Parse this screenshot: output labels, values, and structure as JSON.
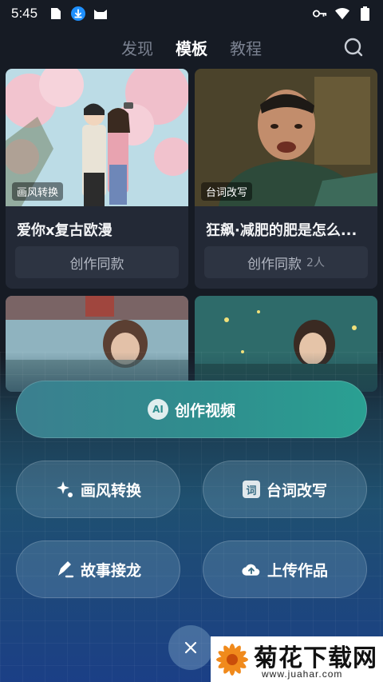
{
  "status_bar": {
    "time": "5:45",
    "left_icons": [
      "file-icon",
      "download-icon",
      "cat-icon"
    ],
    "right_icons": [
      "key-icon",
      "wifi-icon",
      "battery-icon"
    ]
  },
  "tabs": [
    {
      "label": "发现",
      "active": false
    },
    {
      "label": "模板",
      "active": true
    },
    {
      "label": "教程",
      "active": false
    }
  ],
  "cards": [
    {
      "tag": "画风转换",
      "title": "爱你x复古欧漫",
      "button": "创作同款",
      "count": ""
    },
    {
      "tag": "台词改写",
      "title": "狂飙·减肥的肥是怎么...",
      "button": "创作同款",
      "count": "2人"
    }
  ],
  "actions": {
    "create_video": {
      "label": "创作视频",
      "icon": "AI"
    },
    "style_convert": {
      "label": "画风转换"
    },
    "line_rewrite": {
      "label": "台词改写",
      "icon": "词"
    },
    "story_chain": {
      "label": "故事接龙"
    },
    "upload_work": {
      "label": "上传作品"
    }
  },
  "watermark": {
    "text": "菊花下载网",
    "url": "www.juahar.com"
  },
  "colors": {
    "background": "#161b24",
    "card": "#232936",
    "accent": "#2f8e8e"
  }
}
